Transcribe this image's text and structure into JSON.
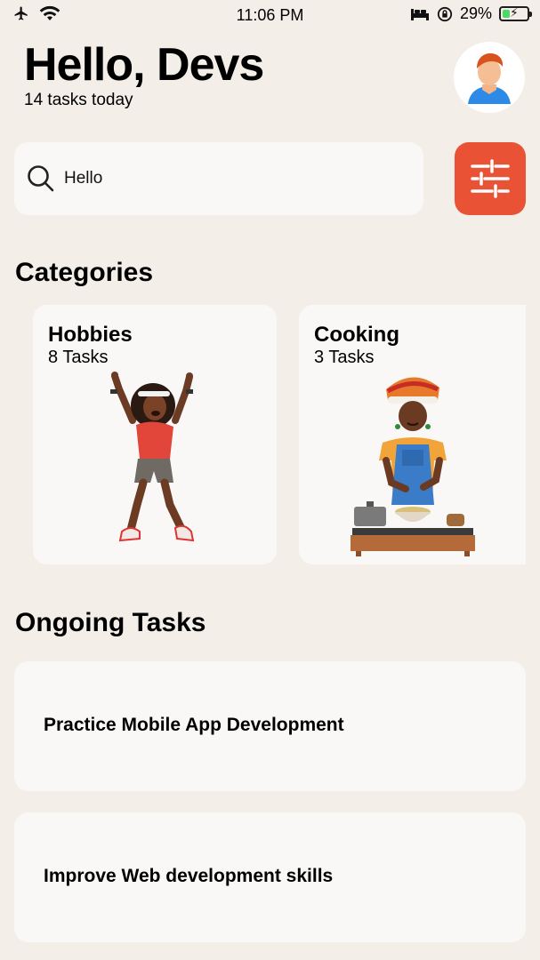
{
  "status_bar": {
    "time": "11:06 PM",
    "battery_percent": "29%",
    "battery_level": 0.29,
    "icons": [
      "airplane-icon",
      "wifi-icon",
      "bed-icon",
      "orientation-lock-icon",
      "battery-icon"
    ]
  },
  "header": {
    "greeting": "Hello, Devs",
    "subtitle": "14 tasks today",
    "avatar_icon": "user-avatar-icon"
  },
  "search": {
    "value": "Hello",
    "icon": "search-icon"
  },
  "filter": {
    "icon": "sliders-icon",
    "color": "#ea5235"
  },
  "categories": {
    "title": "Categories",
    "items": [
      {
        "name": "Hobbies",
        "count": "8 Tasks",
        "illustration": "dancing-woman-illustration"
      },
      {
        "name": "Cooking",
        "count": "3 Tasks",
        "illustration": "cooking-woman-illustration"
      }
    ]
  },
  "ongoing": {
    "title": "Ongoing Tasks",
    "items": [
      {
        "label": "Practice Mobile App Development"
      },
      {
        "label": "Improve Web development skills"
      }
    ]
  },
  "colors": {
    "background": "#f4eee8",
    "card": "#faf8f6",
    "accent": "#ea5235"
  }
}
